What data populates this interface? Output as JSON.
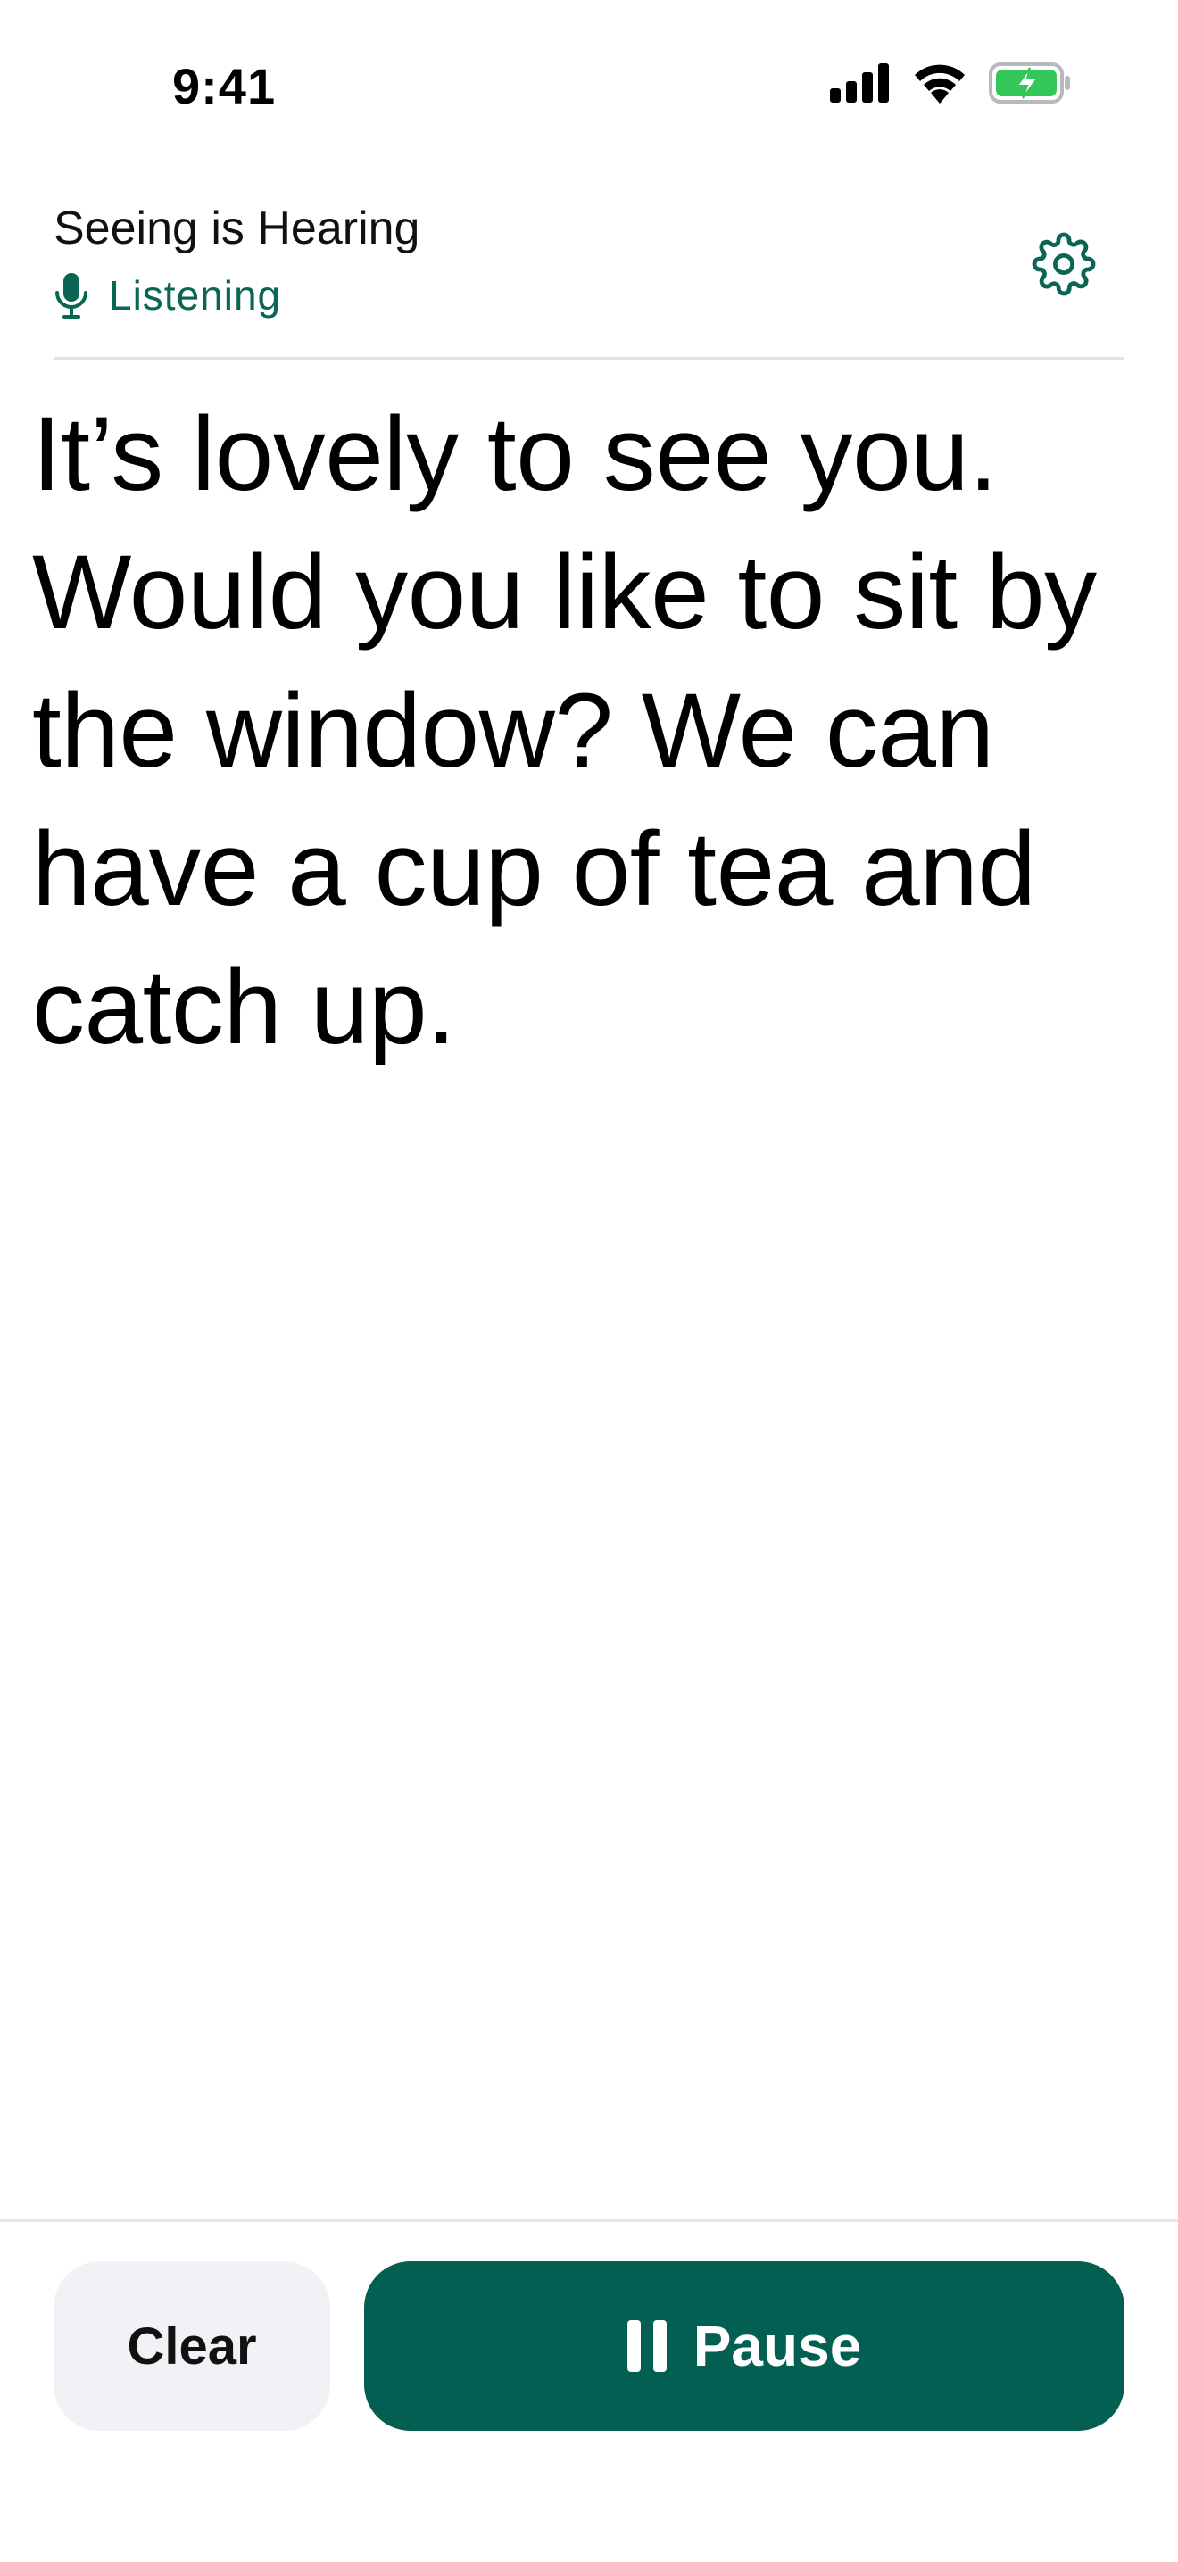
{
  "status_bar": {
    "time": "9:41",
    "icons": [
      "cellular-signal-icon",
      "wifi-icon",
      "battery-charging-icon"
    ],
    "battery_color": "#34c759"
  },
  "header": {
    "title": "Seeing is Hearing",
    "status": "Listening",
    "status_icon": "microphone-icon",
    "settings_icon": "gear-icon",
    "accent_color": "#0a6652"
  },
  "transcript": {
    "text": "It’s lovely to see you. Would you like to sit by the window? We can have a cup of tea and catch up."
  },
  "actions": {
    "clear_label": "Clear",
    "pause_label": "Pause",
    "pause_icon": "pause-icon",
    "primary_color": "#035f52"
  }
}
